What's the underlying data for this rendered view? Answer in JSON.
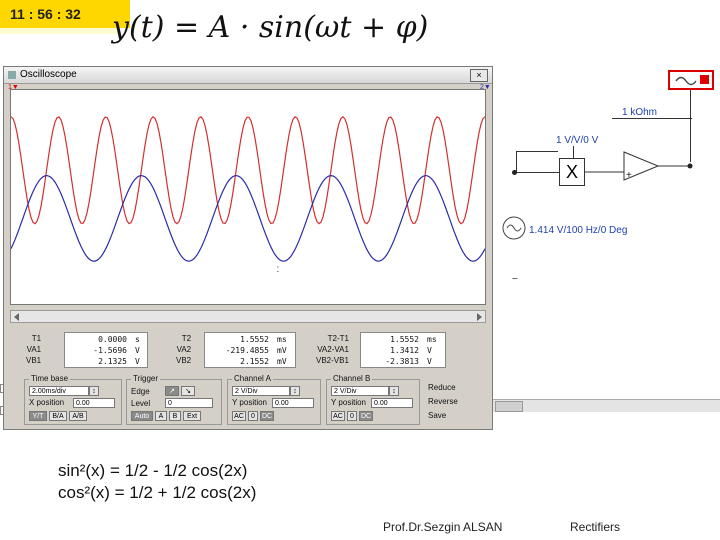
{
  "timer": "11 : 56 : 32",
  "formula": "y(t) = A · sin(ωt + φ)",
  "oscilloscope": {
    "title": "Oscilloscope",
    "close": "×",
    "cursor_markers": [
      "1",
      "2"
    ],
    "readout": {
      "t1": {
        "labels": [
          "T1",
          "VA1",
          "VB1"
        ],
        "values": [
          "0.0000",
          "-1.5696",
          "2.1325"
        ],
        "units": [
          "s",
          "V",
          "V"
        ]
      },
      "t2": {
        "labels": [
          "T2",
          "VA2",
          "VB2"
        ],
        "values": [
          "1.5552",
          "-219.4855",
          "2.1552"
        ],
        "units": [
          "ms",
          "mV",
          "mV"
        ]
      },
      "t21": {
        "labels": [
          "T2-T1",
          "VA2-VA1",
          "VB2-VB1"
        ],
        "values": [
          "1.5552",
          "1.3412",
          "-2.3813"
        ],
        "units": [
          "ms",
          "V",
          "V"
        ]
      }
    },
    "timebase": {
      "label": "Time base",
      "scale": "2.00ms/div",
      "xpos_label": "X position",
      "xpos": "0.00",
      "modes": [
        "Y/T",
        "B/A",
        "A/B"
      ]
    },
    "trigger": {
      "label": "Trigger",
      "edge_label": "Edge",
      "level_label": "Level",
      "level": "0",
      "modes": [
        "Auto",
        "A",
        "B",
        "Ext"
      ]
    },
    "channel_a": {
      "label": "Channel A",
      "scale": "2 V/Div",
      "ypos_label": "Y position",
      "ypos": "0.00",
      "coupling": [
        "AC",
        "0",
        "DC"
      ]
    },
    "channel_b": {
      "label": "Channel B",
      "scale": "2 V/Div",
      "ypos_label": "Y position",
      "ypos": "0.00",
      "coupling": [
        "AC",
        "0",
        "DC"
      ]
    },
    "side_buttons": [
      "Reduce",
      "Reverse",
      "Save"
    ]
  },
  "circuit": {
    "resistor": "1 kOhm",
    "multiplier": "1 V/V/0 V",
    "multiplier_symbol": "X",
    "source": "1.414 V/100 Hz/0 Deg",
    "plus": "+",
    "minus": "−"
  },
  "identities": [
    "sin²(x) = 1/2 - 1/2 cos(2x)",
    "cos²(x) = 1/2 + 1/2 cos(2x)"
  ],
  "footer": {
    "author": "Prof.Dr.Sezgin ALSAN",
    "topic": "Rectifiers"
  },
  "colors": {
    "channel_a": "#d23030",
    "channel_b": "#2c2ca8",
    "timer_bg": "#ffd700"
  },
  "chart_data": {
    "type": "line",
    "series": [
      {
        "color": "#d23030",
        "amplitude_div": 1.0,
        "offset_div": 0.5,
        "period_div": 1.0
      },
      {
        "color": "#2c2ca8",
        "amplitude_div": 0.8,
        "offset_div": -0.4,
        "period_div": 2.0
      }
    ],
    "divisions_x": 10,
    "divisions_y": 4
  }
}
